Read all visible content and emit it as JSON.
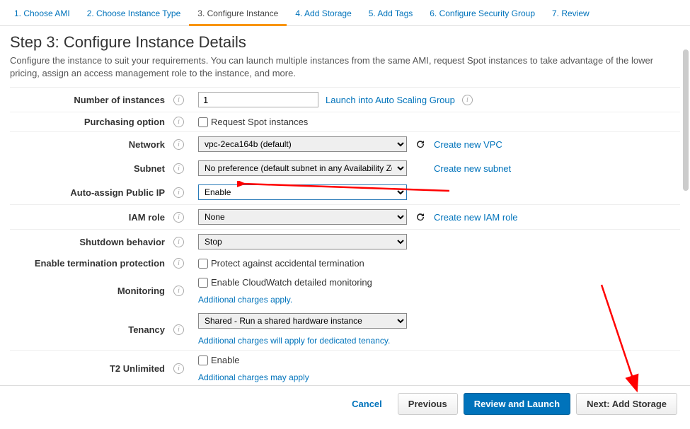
{
  "nav": {
    "tabs": [
      {
        "label": "1. Choose AMI"
      },
      {
        "label": "2. Choose Instance Type"
      },
      {
        "label": "3. Configure Instance"
      },
      {
        "label": "4. Add Storage"
      },
      {
        "label": "5. Add Tags"
      },
      {
        "label": "6. Configure Security Group"
      },
      {
        "label": "7. Review"
      }
    ]
  },
  "header": {
    "title": "Step 3: Configure Instance Details",
    "description": "Configure the instance to suit your requirements. You can launch multiple instances from the same AMI, request Spot instances to take advantage of the lower pricing, assign an access management role to the instance, and more."
  },
  "form": {
    "instances_label": "Number of instances",
    "instances_value": "1",
    "instances_link": "Launch into Auto Scaling Group",
    "purchasing_label": "Purchasing option",
    "purchasing_checkbox": "Request Spot instances",
    "network_label": "Network",
    "network_value": "vpc-2eca164b (default)",
    "network_link": "Create new VPC",
    "subnet_label": "Subnet",
    "subnet_value": "No preference (default subnet in any Availability Zone)",
    "subnet_link": "Create new subnet",
    "publicip_label": "Auto-assign Public IP",
    "publicip_value": "Enable",
    "iam_label": "IAM role",
    "iam_value": "None",
    "iam_link": "Create new IAM role",
    "shutdown_label": "Shutdown behavior",
    "shutdown_value": "Stop",
    "termination_label": "Enable termination protection",
    "termination_checkbox": "Protect against accidental termination",
    "monitoring_label": "Monitoring",
    "monitoring_checkbox": "Enable CloudWatch detailed monitoring",
    "monitoring_note": "Additional charges apply.",
    "tenancy_label": "Tenancy",
    "tenancy_value": "Shared - Run a shared hardware instance",
    "tenancy_note": "Additional charges will apply for dedicated tenancy.",
    "t2_label": "T2 Unlimited",
    "t2_checkbox": "Enable",
    "t2_note": "Additional charges may apply"
  },
  "footer": {
    "cancel": "Cancel",
    "previous": "Previous",
    "review": "Review and Launch",
    "next": "Next: Add Storage"
  }
}
